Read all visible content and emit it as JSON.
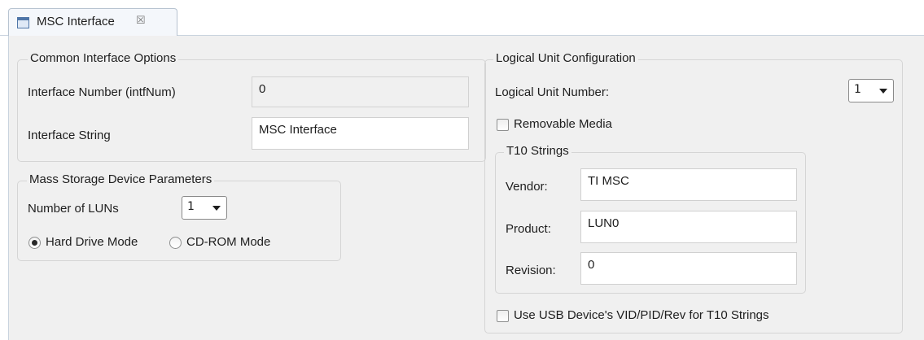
{
  "tab": {
    "title": "MSC Interface",
    "close_glyph": "☒",
    "icon": "editor-icon"
  },
  "common": {
    "group_title": "Common Interface Options",
    "interface_number_label": "Interface Number (intfNum)",
    "interface_number_value": "0",
    "interface_string_label": "Interface String",
    "interface_string_value": "MSC Interface"
  },
  "mass_storage": {
    "group_title": "Mass Storage Device Parameters",
    "num_luns_label": "Number of LUNs",
    "num_luns_value": "1",
    "hard_drive_label": "Hard Drive Mode",
    "hard_drive_selected": true,
    "cdrom_label": "CD-ROM Mode",
    "cdrom_selected": false
  },
  "logical_unit": {
    "group_title": "Logical Unit Configuration",
    "lun_label": "Logical Unit Number:",
    "lun_value": "1",
    "removable_label": "Removable Media",
    "removable_checked": false,
    "t10": {
      "group_title": "T10 Strings",
      "vendor_label": "Vendor:",
      "vendor_value": "TI MSC",
      "product_label": "Product:",
      "product_value": "LUN0",
      "revision_label": "Revision:",
      "revision_value": "0"
    },
    "use_usb_label": "Use USB Device's VID/PID/Rev for T10 Strings",
    "use_usb_checked": false
  }
}
